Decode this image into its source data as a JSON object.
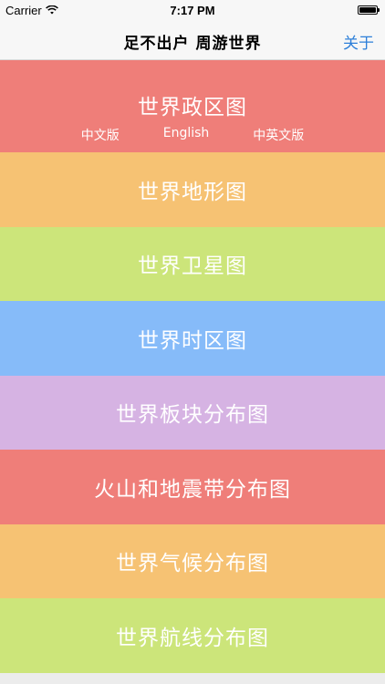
{
  "status_bar": {
    "carrier": "Carrier",
    "time": "7:17 PM",
    "wifi_icon": "wifi-icon",
    "battery_icon": "battery-icon"
  },
  "nav": {
    "title": "足不出户  周游世界",
    "about": "关于"
  },
  "menu": {
    "items": [
      {
        "label": "世界政区图",
        "color": "#ef7e79",
        "sub_options": [
          "中文版",
          "English",
          "中英文版"
        ]
      },
      {
        "label": "世界地形图",
        "color": "#f6c273"
      },
      {
        "label": "世界卫星图",
        "color": "#cce57a"
      },
      {
        "label": "世界时区图",
        "color": "#86bbf9"
      },
      {
        "label": "世界板块分布图",
        "color": "#d6b3e3"
      },
      {
        "label": "火山和地震带分布图",
        "color": "#ef7e79"
      },
      {
        "label": "世界气候分布图",
        "color": "#f6c273"
      },
      {
        "label": "世界航线分布图",
        "color": "#cce57a"
      }
    ]
  }
}
